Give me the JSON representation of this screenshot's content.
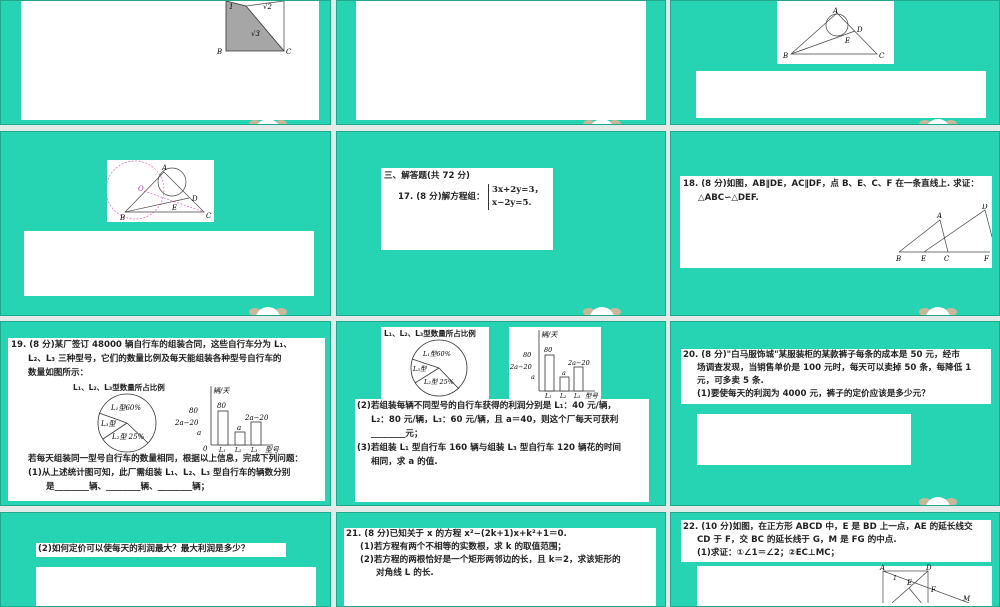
{
  "slides": {
    "s1": {
      "fig": {
        "b": "B",
        "c": "C",
        "r3": "√3",
        "r2": "√2",
        "one": "1"
      }
    },
    "s3": {
      "fig": {
        "a": "A",
        "b": "B",
        "c": "C",
        "d": "D",
        "e": "E"
      }
    },
    "s4": {
      "fig": {
        "a": "A",
        "b": "B",
        "c": "C",
        "d": "D",
        "e": "E",
        "o": "O"
      }
    },
    "s5": {
      "section": "三、解答题(共 72 分)",
      "q17": "17. (8 分)解方程组：",
      "eq1": "3x+2y=3，",
      "eq2": "x−2y=5."
    },
    "s6": {
      "q18_l1": "18. (8 分)如图，AB∥DE，AC∥DF，点 B、E、C、F 在一条直线上. 求证：",
      "q18_l2": "△ABC∽△DEF.",
      "fig": {
        "a": "A",
        "b": "B",
        "c": "C",
        "d": "D",
        "e": "E",
        "f": "F"
      }
    },
    "s7": {
      "l1": "19. (8 分)某厂签订 48000 辆自行车的组装合同，这些自行车分为 L₁、",
      "l2": "L₂、L₃ 三种型号，它们的数量比例及每天能组装各种型号自行车的",
      "l3": "数量如图所示：",
      "l4": "若每天组装同一型号自行车的数量相同，根据以上信息，完成下列问题：",
      "l5": "(1)从上述统计图可知，此厂需组装 L₁、L₂、L₃ 型自行车的辆数分别",
      "l6": "是________辆、________辆、________辆；"
    },
    "s8": {
      "l1": "(2)若组装每辆不同型号的自行车获得的利润分别是 L₁：40 元/辆，",
      "l2": "L₂：80 元/辆，L₃：60 元/辆，且 a＝40，则这个厂每天可获利",
      "l3": "________元；",
      "l4": "(3)若组装 L₁ 型自行车 160 辆与组装 L₃ 型自行车 120 辆花的时间",
      "l5": "相同，求 a 的值."
    },
    "s9": {
      "l1": "20. (8 分)\"白马服饰城\"某服装柜的某款裤子每条的成本是 50 元，经市",
      "l2": "场调查发现，当销售单价是 100 元时，每天可以卖掉 50 条，每降低 1",
      "l3": "元，可多卖 5 条.",
      "l4": "(1)要使每天的利润为 4000 元，裤子的定价应该是多少元？"
    },
    "s10": {
      "l1": "(2)如何定价可以使每天的利润最大？最大利润是多少？"
    },
    "s11": {
      "l1": "21. (8 分)已知关于 x 的方程 x²−(2k+1)x+k²+1＝0.",
      "l2": "(1)若方程有两个不相等的实数根，求 k 的取值范围；",
      "l3": "(2)若方程的两根恰好是一个矩形两邻边的长，且 k＝2，求该矩形的",
      "l4": "对角线 L 的长."
    },
    "s12": {
      "l1": "22. (10 分)如图，在正方形 ABCD 中，E 是 BD 上一点，AE 的延长线交",
      "l2": "CD 于 F，交 BC 的延长线于 G，M 是 FG 的中点.",
      "l3": "(1)求证：①∠1＝∠2；②EC⊥MC；",
      "fig": {
        "a": "A",
        "d": "D",
        "e": "E",
        "f": "F",
        "m": "M",
        "one": "1"
      }
    }
  },
  "chart_data": [
    {
      "type": "pie",
      "title": "L₁、L₂、L₃型数量所占比例",
      "labels": [
        "L₁型60%",
        "L₃型",
        "L₂型 25%"
      ],
      "values": [
        60,
        15,
        25
      ]
    },
    {
      "type": "bar",
      "ylabel": "辆/天",
      "xlabel": "型号",
      "categories": [
        "L₁",
        "L₂",
        "L₃"
      ],
      "value_labels": [
        "80",
        "a",
        "2a−20"
      ],
      "yticks": [
        "80",
        "2a−20",
        "a",
        "0"
      ]
    }
  ],
  "colors": {
    "background": "#26d3b3",
    "gap": "#e3ebe8"
  }
}
